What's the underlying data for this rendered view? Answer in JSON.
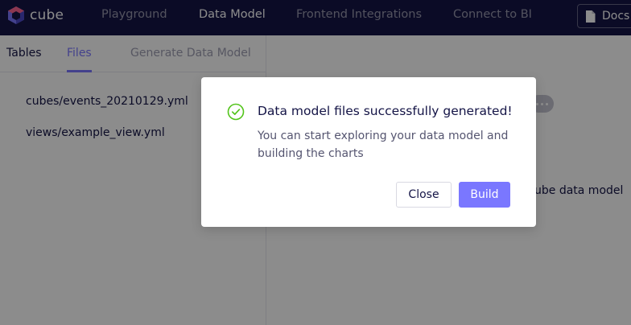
{
  "app": {
    "logo_text": "cube",
    "brand_color": "#7a77ff",
    "header_bg": "#141446"
  },
  "nav": {
    "items": [
      {
        "label": "Playground"
      },
      {
        "label": "Data Model",
        "active": true
      },
      {
        "label": "Frontend Integrations"
      },
      {
        "label": "Connect to BI"
      }
    ],
    "docs_label": "Docs"
  },
  "left_panel": {
    "tabs": [
      {
        "label": "Tables"
      },
      {
        "label": "Files",
        "active": true
      },
      {
        "label": "Generate Data Model",
        "disabled": true
      }
    ],
    "files": [
      "cubes/events_20210129.yml",
      "views/example_view.yml"
    ]
  },
  "right_panel": {
    "text": "ube data model"
  },
  "modal": {
    "icon": "check-circle-icon",
    "success_color": "#52c41a",
    "title": "Data model files successfully generated!",
    "description": "You can start exploring your data model and building the charts",
    "close_label": "Close",
    "build_label": "Build"
  }
}
